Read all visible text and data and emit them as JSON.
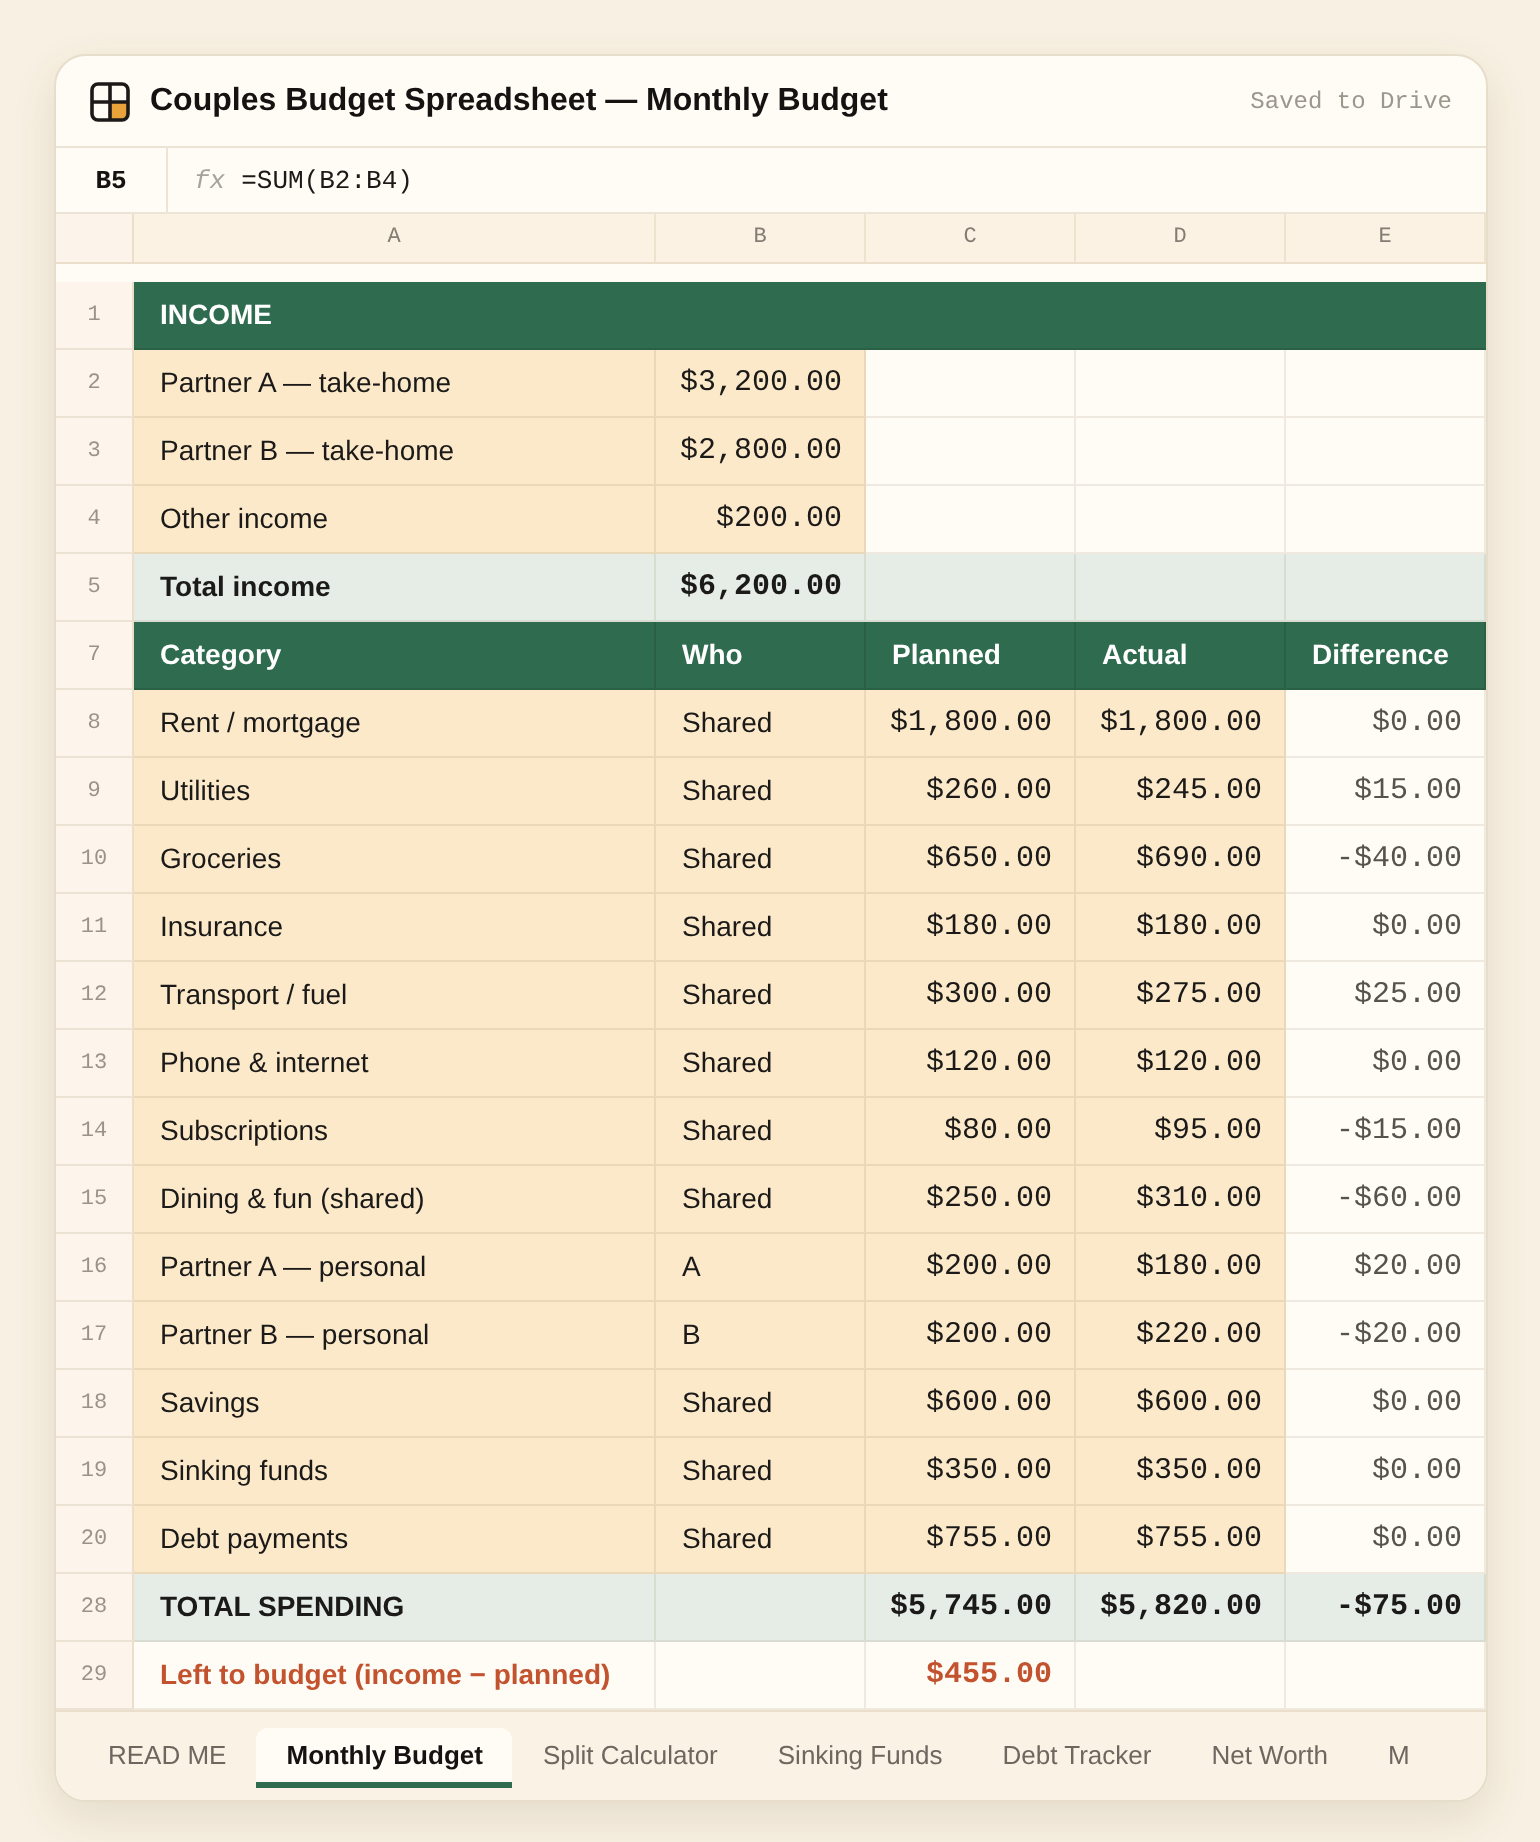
{
  "window": {
    "title": "Couples Budget Spreadsheet — Monthly Budget",
    "status": "Saved to Drive"
  },
  "formula_bar": {
    "cell": "B5",
    "fx_label": "fx",
    "formula": "=SUM(B2:B4)"
  },
  "columns": [
    "A",
    "B",
    "C",
    "D",
    "E"
  ],
  "rows": [
    {
      "number": "1",
      "kind": "section",
      "cells": {
        "a": "INCOME"
      }
    },
    {
      "number": "2",
      "kind": "income",
      "cells": {
        "a": "Partner A — take-home",
        "b": "$3,200.00"
      }
    },
    {
      "number": "3",
      "kind": "income",
      "cells": {
        "a": "Partner B — take-home",
        "b": "$2,800.00"
      }
    },
    {
      "number": "4",
      "kind": "income",
      "cells": {
        "a": "Other income",
        "b": "$200.00"
      }
    },
    {
      "number": "5",
      "kind": "total",
      "cells": {
        "a": "Total income",
        "b": "$6,200.00"
      }
    },
    {
      "number": "7",
      "kind": "header",
      "cells": {
        "a": "Category",
        "b": "Who",
        "c": "Planned",
        "d": "Actual",
        "e": "Difference"
      }
    },
    {
      "number": "8",
      "kind": "expense",
      "cells": {
        "a": "Rent / mortgage",
        "b": "Shared",
        "c": "$1,800.00",
        "d": "$1,800.00",
        "e": "$0.00"
      }
    },
    {
      "number": "9",
      "kind": "expense",
      "cells": {
        "a": "Utilities",
        "b": "Shared",
        "c": "$260.00",
        "d": "$245.00",
        "e": "$15.00"
      }
    },
    {
      "number": "10",
      "kind": "expense",
      "cells": {
        "a": "Groceries",
        "b": "Shared",
        "c": "$650.00",
        "d": "$690.00",
        "e": "-$40.00"
      }
    },
    {
      "number": "11",
      "kind": "expense",
      "cells": {
        "a": "Insurance",
        "b": "Shared",
        "c": "$180.00",
        "d": "$180.00",
        "e": "$0.00"
      }
    },
    {
      "number": "12",
      "kind": "expense",
      "cells": {
        "a": "Transport / fuel",
        "b": "Shared",
        "c": "$300.00",
        "d": "$275.00",
        "e": "$25.00"
      }
    },
    {
      "number": "13",
      "kind": "expense",
      "cells": {
        "a": "Phone & internet",
        "b": "Shared",
        "c": "$120.00",
        "d": "$120.00",
        "e": "$0.00"
      }
    },
    {
      "number": "14",
      "kind": "expense",
      "cells": {
        "a": "Subscriptions",
        "b": "Shared",
        "c": "$80.00",
        "d": "$95.00",
        "e": "-$15.00"
      }
    },
    {
      "number": "15",
      "kind": "expense",
      "cells": {
        "a": "Dining & fun (shared)",
        "b": "Shared",
        "c": "$250.00",
        "d": "$310.00",
        "e": "-$60.00"
      }
    },
    {
      "number": "16",
      "kind": "expense",
      "cells": {
        "a": "Partner A — personal",
        "b": "A",
        "c": "$200.00",
        "d": "$180.00",
        "e": "$20.00"
      }
    },
    {
      "number": "17",
      "kind": "expense",
      "cells": {
        "a": "Partner B — personal",
        "b": "B",
        "c": "$200.00",
        "d": "$220.00",
        "e": "-$20.00"
      }
    },
    {
      "number": "18",
      "kind": "expense",
      "cells": {
        "a": "Savings",
        "b": "Shared",
        "c": "$600.00",
        "d": "$600.00",
        "e": "$0.00"
      }
    },
    {
      "number": "19",
      "kind": "expense",
      "cells": {
        "a": "Sinking funds",
        "b": "Shared",
        "c": "$350.00",
        "d": "$350.00",
        "e": "$0.00"
      }
    },
    {
      "number": "20",
      "kind": "expense",
      "cells": {
        "a": "Debt payments",
        "b": "Shared",
        "c": "$755.00",
        "d": "$755.00",
        "e": "$0.00"
      }
    },
    {
      "number": "28",
      "kind": "total",
      "cells": {
        "a": "TOTAL SPENDING",
        "c": "$5,745.00",
        "d": "$5,820.00",
        "e": "-$75.00"
      }
    },
    {
      "number": "29",
      "kind": "summary",
      "cells": {
        "a": "Left to budget (income − planned)",
        "c": "$455.00"
      }
    }
  ],
  "sheet_tabs": [
    {
      "label": "READ ME",
      "selected": false
    },
    {
      "label": "Monthly Budget",
      "selected": true
    },
    {
      "label": "Split Calculator",
      "selected": false
    },
    {
      "label": "Sinking Funds",
      "selected": false
    },
    {
      "label": "Debt Tracker",
      "selected": false
    },
    {
      "label": "Net Worth",
      "selected": false
    },
    {
      "label": "M",
      "selected": false
    }
  ]
}
